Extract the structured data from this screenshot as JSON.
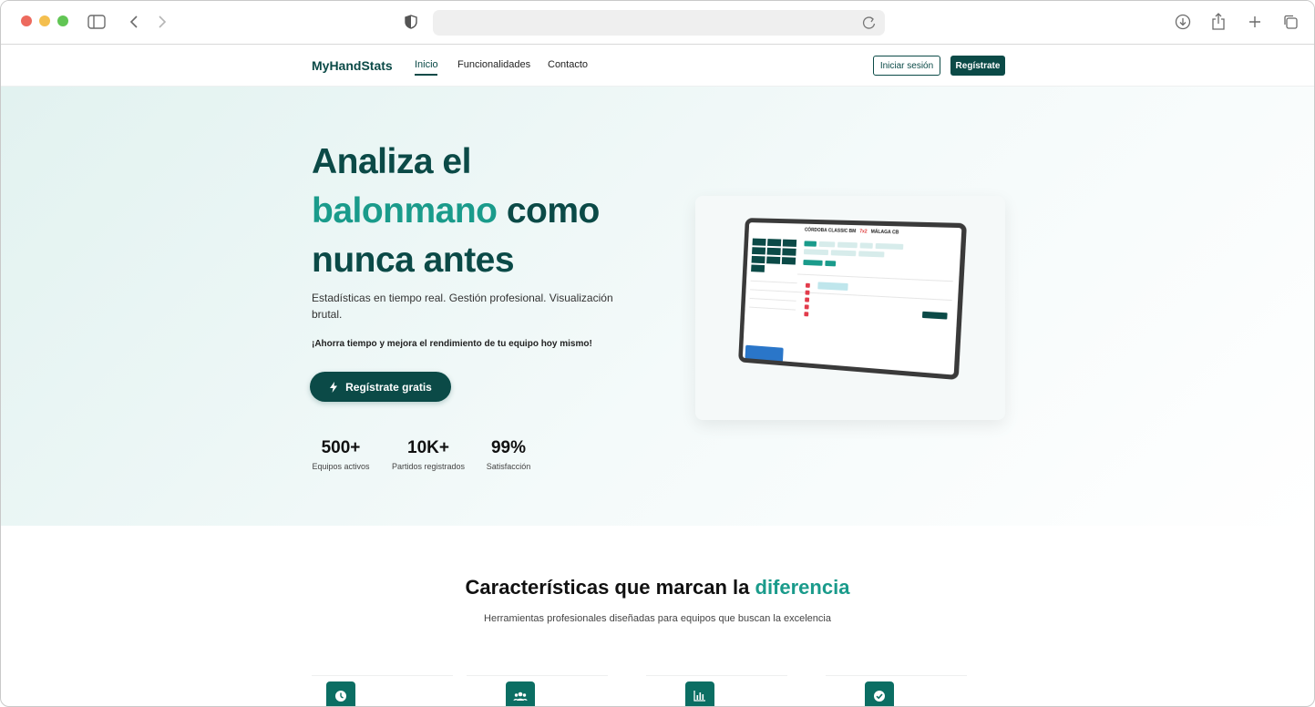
{
  "browser": {
    "url": "",
    "traffic_lights": [
      "#ed6a5e",
      "#f4bf4f",
      "#61c554"
    ]
  },
  "nav": {
    "brand": "MyHandStats",
    "links": [
      "Inicio",
      "Funcionalidades",
      "Contacto"
    ],
    "login_label": "Iniciar sesión",
    "register_label": "Regístrate"
  },
  "hero": {
    "title_line1": "Analiza el",
    "title_highlight": "balonmano",
    "title_line2_rest": " como",
    "title_line3": "nunca antes",
    "subtitle": "Estadísticas en tiempo real. Gestión profesional. Visualización brutal.",
    "cta_text": "¡Ahorra tiempo y mejora el rendimiento de tu equipo hoy mismo!",
    "cta_button": "Regístrate gratis",
    "stats": [
      {
        "value": "500+",
        "label": "Equipos activos"
      },
      {
        "value": "10K+",
        "label": "Partidos registrados"
      },
      {
        "value": "99%",
        "label": "Satisfacción"
      }
    ],
    "mockup": {
      "team_home": "CÓRDOBA CLASSIC BM",
      "score": "7x2",
      "team_away": "MÁLAGA CB"
    }
  },
  "features": {
    "title_main": "Características que marcan la ",
    "title_highlight": "diferencia",
    "subtitle": "Herramientas profesionales diseñadas para equipos que buscan la excelencia",
    "icons": [
      "clock-icon",
      "users-icon",
      "chart-icon",
      "check-icon"
    ]
  },
  "colors": {
    "brand_dark": "#0b4a47",
    "brand_accent": "#1a9b8b"
  }
}
